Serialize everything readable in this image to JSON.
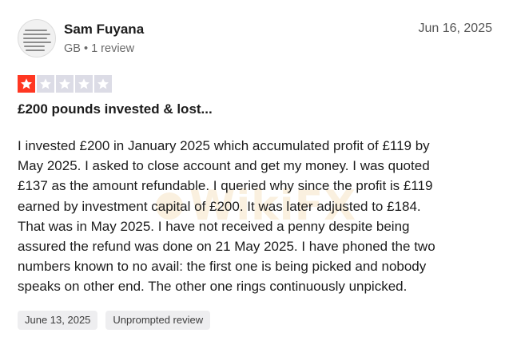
{
  "review": {
    "author": {
      "name": "Sam Fuyana",
      "meta": "GB • 1 review",
      "avatar_icon": "avatar-screenshot-thumbnail"
    },
    "date": "Jun 16, 2025",
    "rating": {
      "value": 1,
      "max": 5,
      "filled_color": "#ff3722",
      "empty_color": "#dcdce6"
    },
    "title": "£200 pounds invested & lost...",
    "body": "I invested £200 in January 2025 which accumulated profit of £119 by\nMay 2025. I asked to close account and get my money. I was quoted\n£137 as the amount refundable. I queried why since the profit is £119\nearned by investment capital of £200. It was later adjusted to £184.\nThat was in May 2025. I have not received a penny despite being\nassured the refund was done on 21 May 2025. I have phoned the two\nnumbers known to no avail: the first one is being picked and nobody\nspeaks on other end. The other one rings continuously unpicked.",
    "tags": [
      {
        "label": "June 13, 2025"
      },
      {
        "label": "Unprompted review"
      }
    ]
  },
  "watermark": {
    "text": "WikiFX"
  }
}
